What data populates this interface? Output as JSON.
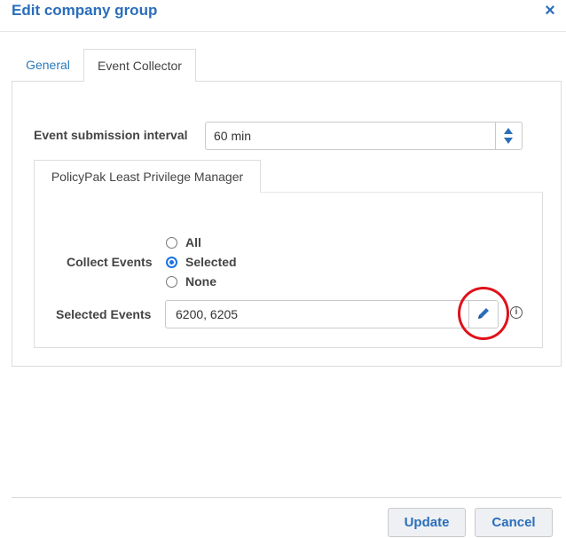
{
  "dialog": {
    "title": "Edit company group",
    "close_symbol": "×"
  },
  "tabs": [
    {
      "label": "General",
      "active": false
    },
    {
      "label": "Event Collector",
      "active": true
    }
  ],
  "event_collector": {
    "interval_label": "Event submission interval",
    "interval_value": "60 min",
    "inner_tab_label": "PolicyPak Least Privilege Manager",
    "collect_events_label": "Collect Events",
    "options": [
      {
        "label": "All",
        "checked": false
      },
      {
        "label": "Selected",
        "checked": true
      },
      {
        "label": "None",
        "checked": false
      }
    ],
    "selected_events_label": "Selected Events",
    "selected_events_value": "6200, 6205",
    "info_symbol": "i"
  },
  "footer": {
    "update_label": "Update",
    "cancel_label": "Cancel"
  },
  "colors": {
    "accent": "#2a6ebb",
    "radio_selected": "#1a73e8",
    "highlight_circle": "#e0121a"
  },
  "icons": [
    "close-icon",
    "spin-up-icon",
    "spin-down-icon",
    "pencil-icon",
    "info-icon"
  ]
}
